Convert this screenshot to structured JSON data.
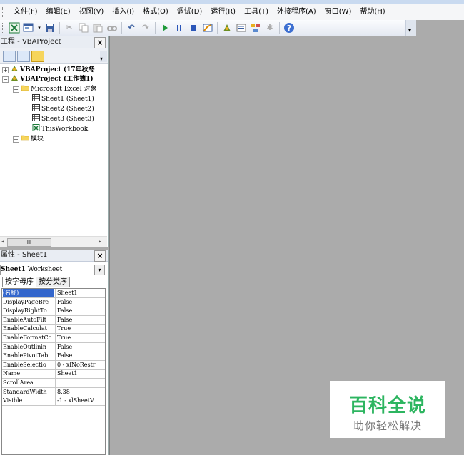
{
  "menu": [
    "文件(F)",
    "编辑(E)",
    "视图(V)",
    "插入(I)",
    "格式(O)",
    "调试(D)",
    "运行(R)",
    "工具(T)",
    "外接程序(A)",
    "窗口(W)",
    "帮助(H)"
  ],
  "toolbar_icons": [
    "excel-icon",
    "insert-userform-icon",
    "save-icon",
    "cut-icon",
    "copy-icon",
    "paste-icon",
    "find-icon",
    "undo-icon",
    "redo-icon",
    "run-icon",
    "pause-icon",
    "stop-icon",
    "design-mode-icon",
    "project-explorer-icon",
    "properties-icon",
    "object-browser-icon",
    "toolbox-icon",
    "help-icon"
  ],
  "project": {
    "title": "工程 - VBAProject",
    "close": "×",
    "tree": {
      "vbaproject1": "VBAProject (17年秋冬",
      "vbaproject2": "VBAProject (工作簿1)",
      "excel_objects": "Microsoft Excel 对象",
      "sheet1": "Sheet1 (Sheet1)",
      "sheet2": "Sheet2 (Sheet2)",
      "sheet3": "Sheet3 (Sheet3)",
      "thisworkbook": "ThisWorkbook",
      "modules": "模块"
    },
    "scroll_thumb": "III"
  },
  "properties": {
    "title": "属性 - Sheet1",
    "close": "×",
    "object_name": "Sheet1",
    "object_type": "Worksheet",
    "tabs": [
      "按字母序",
      "按分类序"
    ],
    "rows": [
      {
        "name": "(名称)",
        "value": "Sheet1"
      },
      {
        "name": "DisplayPageBre",
        "value": "False"
      },
      {
        "name": "DisplayRightTo",
        "value": "False"
      },
      {
        "name": "EnableAutoFilt",
        "value": "False"
      },
      {
        "name": "EnableCalculat",
        "value": "True"
      },
      {
        "name": "EnableFormatCo",
        "value": "True"
      },
      {
        "name": "EnableOutlinin",
        "value": "False"
      },
      {
        "name": "EnablePivotTab",
        "value": "False"
      },
      {
        "name": "EnableSelectio",
        "value": "0 - xlNoRestr"
      },
      {
        "name": "Name",
        "value": "Sheet1"
      },
      {
        "name": "ScrollArea",
        "value": ""
      },
      {
        "name": "StandardWidth",
        "value": "8.38"
      },
      {
        "name": "Visible",
        "value": "-1 - xlSheetV"
      }
    ]
  },
  "watermark": {
    "title": "百科全说",
    "subtitle": "助你轻松解决"
  },
  "colors": {
    "workspace": "#ababab",
    "selection": "#3366cc",
    "watermark_green": "#2db560"
  }
}
